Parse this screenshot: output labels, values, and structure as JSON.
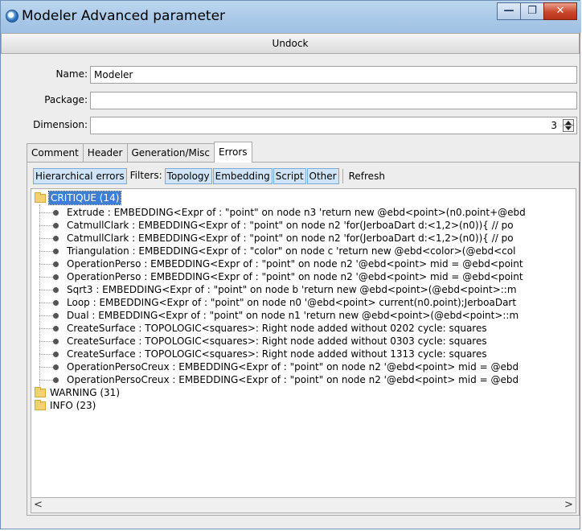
{
  "window": {
    "title": "Modeler Advanced parameter",
    "controls": {
      "minimize": "—",
      "maximize": "❐",
      "close": "✕"
    }
  },
  "undock_label": "Undock",
  "fields": {
    "name": {
      "label": "Name:",
      "value": "Modeler"
    },
    "package": {
      "label": "Package:",
      "value": ""
    },
    "dimension": {
      "label": "Dimension:",
      "value": "3"
    }
  },
  "tabs": [
    {
      "label": "Comment",
      "active": false
    },
    {
      "label": "Header",
      "active": false
    },
    {
      "label": "Generation/Misc",
      "active": false
    },
    {
      "label": "Errors",
      "active": true
    }
  ],
  "toolbar": {
    "hierarchical": "Hierarchical errors",
    "filters_label": "Filters:",
    "filters": [
      "Topology",
      "Embedding",
      "Script",
      "Other"
    ],
    "refresh": "Refresh"
  },
  "tree": {
    "critique": {
      "label": "CRITIQUE (14)",
      "items": [
        "Extrude : EMBEDDING<Expr of : \"point\" on node n3 'return new @ebd<point>(n0.point+@ebd",
        "CatmullClark : EMBEDDING<Expr of : \"point\" on node n2 'for(JerboaDart d:<1,2>(n0)){ // po",
        "CatmullClark : EMBEDDING<Expr of : \"point\" on node n2 'for(JerboaDart d:<1,2>(n0)){ // po",
        "Triangulation : EMBEDDING<Expr of : \"color\" on node c 'return new @ebd<color>(@ebd<col",
        "OperationPerso : EMBEDDING<Expr of : \"point\" on node n2 '@ebd<point> mid = @ebd<point",
        "OperationPerso : EMBEDDING<Expr of : \"point\" on node n2 '@ebd<point> mid = @ebd<point",
        "Sqrt3 : EMBEDDING<Expr of : \"point\" on node b 'return new @ebd<point>(@ebd<point>::m",
        "Loop : EMBEDDING<Expr of : \"point\" on node n0 '@ebd<point> current(n0.point);JerboaDart",
        "Dual : EMBEDDING<Expr of : \"point\" on node n1 'return new @ebd<point>(@ebd<point>::m",
        "CreateSurface : TOPOLOGIC<squares>: Right node added without 0202 cycle: squares",
        "CreateSurface : TOPOLOGIC<squares>: Right node added without 0303 cycle: squares",
        "CreateSurface : TOPOLOGIC<squares>: Right node added without 1313 cycle: squares",
        "OperationPersoCreux : EMBEDDING<Expr of : \"point\" on node n2 '@ebd<point> mid = @ebd",
        "OperationPersoCreux : EMBEDDING<Expr of : \"point\" on node n2 '@ebd<point> mid = @ebd"
      ]
    },
    "warning": {
      "label": "WARNING (31)"
    },
    "info": {
      "label": "INFO (23)"
    }
  },
  "scroll": {
    "left": "<",
    "right": ">"
  },
  "colors": {
    "selection": "#3d7fd4",
    "toggled_button": "#cfe4f7",
    "folder": "#f3d16e"
  }
}
